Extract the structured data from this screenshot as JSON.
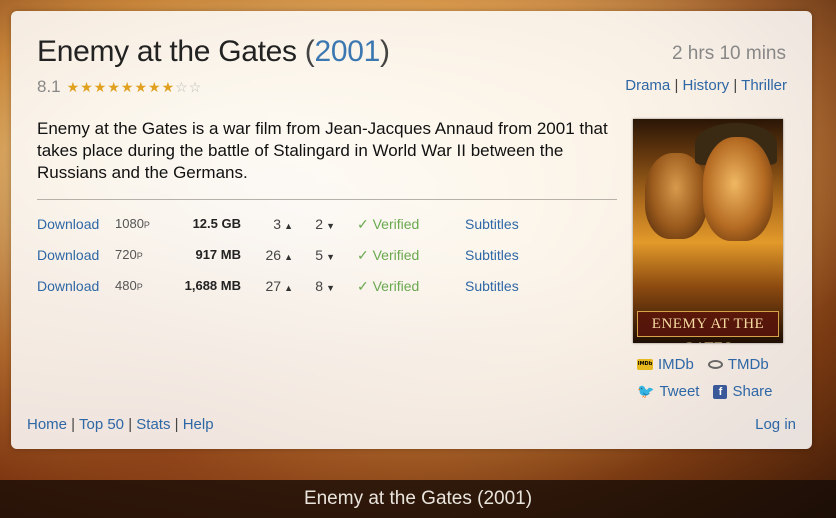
{
  "movie": {
    "title": "Enemy at the Gates",
    "year": "2001",
    "rating": "8.1",
    "stars_filled": 8,
    "stars_total": 10,
    "runtime": "2 hrs 10 mins",
    "genres": [
      "Drama",
      "History",
      "Thriller"
    ],
    "synopsis": "Enemy at the Gates is a war film from Jean-Jacques Annaud from 2001 that takes place during the battle of Stalingard in World War II between the Russians and the Germans.",
    "poster_title": "ENEMY AT THE GATES"
  },
  "downloads": [
    {
      "link_label": "Download",
      "res": "1080",
      "res_suffix": "P",
      "size": "12.5 GB",
      "seeds": "3",
      "peers": "2",
      "verified": "✓ Verified",
      "subtitles": "Subtitles"
    },
    {
      "link_label": "Download",
      "res": "720",
      "res_suffix": "P",
      "size": "917 MB",
      "seeds": "26",
      "peers": "5",
      "verified": "✓ Verified",
      "subtitles": "Subtitles"
    },
    {
      "link_label": "Download",
      "res": "480",
      "res_suffix": "P",
      "size": "1,688 MB",
      "seeds": "27",
      "peers": "8",
      "verified": "✓ Verified",
      "subtitles": "Subtitles"
    }
  ],
  "external": {
    "imdb": "IMDb",
    "tmdb": "TMDb",
    "tweet": "Tweet",
    "share": "Share"
  },
  "nav": {
    "home": "Home",
    "top50": "Top 50",
    "stats": "Stats",
    "help": "Help",
    "login": "Log in"
  },
  "caption": "Enemy at the Gates (2001)",
  "colors": {
    "link": "#2e67a5",
    "verified": "#6aa84f",
    "star": "#e0a020"
  }
}
